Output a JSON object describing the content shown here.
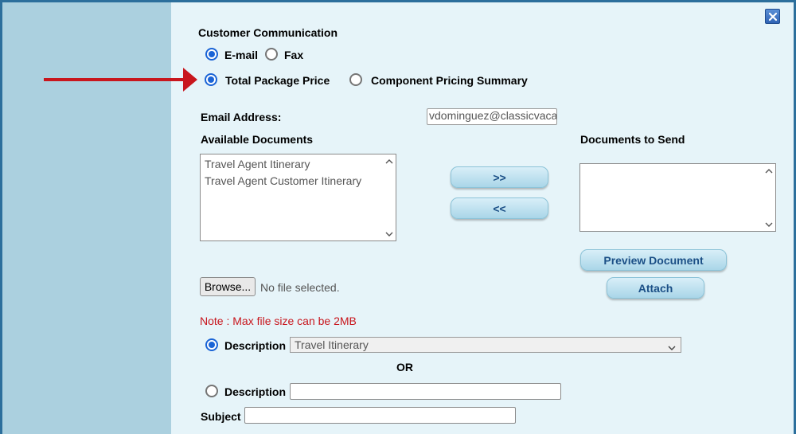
{
  "form": {
    "title": "Customer Communication",
    "method_options": [
      {
        "label": "E-mail",
        "selected": true
      },
      {
        "label": "Fax",
        "selected": false
      }
    ],
    "pricing_options": [
      {
        "label": "Total Package Price",
        "selected": true
      },
      {
        "label": "Component Pricing Summary",
        "selected": false
      }
    ],
    "email_label": "Email Address:",
    "email_value": "vdominguez@classicvacatio",
    "available_label": "Available Documents",
    "available_items": [
      "Travel Agent Itinerary",
      "Travel Agent Customer Itinerary"
    ],
    "send_label": "Documents to Send",
    "send_items": [],
    "move_right_label": ">>",
    "move_left_label": "<<",
    "preview_label": "Preview Document",
    "attach_label": "Attach",
    "browse_label": "Browse...",
    "file_status": "No file selected.",
    "note": "Note : Max file size can be 2MB",
    "description_label": "Description",
    "description_select_value": "Travel Itinerary",
    "or_label": "OR",
    "description_text_value": "",
    "subject_label": "Subject",
    "subject_value": ""
  },
  "colors": {
    "accent": "#1a64d6",
    "annotation_arrow": "#c8161d",
    "note_text": "#c8161d",
    "button_text": "#1b4f86"
  },
  "icons": {
    "close": "close-icon",
    "annotation": "red-arrow-icon"
  }
}
